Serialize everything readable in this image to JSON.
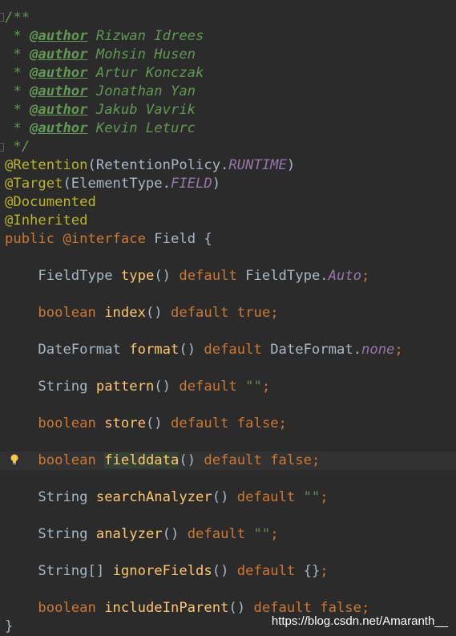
{
  "doc": {
    "open": "/**",
    "star": " * ",
    "author_tag": "@author",
    "authors": [
      "Rizwan Idrees",
      "Mohsin Husen",
      "Artur Konczak",
      "Jonathan Yan",
      "Jakub Vavrik",
      "Kevin Leturc"
    ],
    "close": " */"
  },
  "annotations": {
    "retention": "@Retention",
    "retention_arg": "RetentionPolicy.",
    "retention_const": "RUNTIME",
    "target": "@Target",
    "target_arg": "ElementType.",
    "target_const": "FIELD",
    "documented": "@Documented",
    "inherited": "@Inherited"
  },
  "declaration": {
    "public": "public",
    "at_interface": "@interface",
    "name": "Field",
    "open_brace": "{",
    "close_brace": "}"
  },
  "default_kw": "default",
  "methods": [
    {
      "type": "FieldType",
      "name": "type",
      "default_ref": "FieldType.",
      "default_const": "Auto"
    },
    {
      "type": "boolean",
      "name": "index",
      "default_literal": "true"
    },
    {
      "type": "DateFormat",
      "name": "format",
      "default_ref": "DateFormat.",
      "default_const": "none"
    },
    {
      "type": "String",
      "name": "pattern",
      "default_string": "\"\""
    },
    {
      "type": "boolean",
      "name": "store",
      "default_literal": "false"
    },
    {
      "type": "boolean",
      "name": "fielddata",
      "default_literal": "false"
    },
    {
      "type": "String",
      "name": "searchAnalyzer",
      "default_string": "\"\""
    },
    {
      "type": "String",
      "name": "analyzer",
      "default_string": "\"\""
    },
    {
      "type": "String[]",
      "name": "ignoreFields",
      "default_plain": "{}"
    },
    {
      "type": "boolean",
      "name": "includeInParent",
      "default_literal": "false"
    }
  ],
  "icons": {
    "bulb": "lightbulb-icon"
  },
  "watermark": "https://blog.csdn.net/Amaranth__",
  "colors": {
    "background": "#2b2b2b",
    "doc_comment": "#629755",
    "annotation": "#bbb529",
    "keyword": "#cc7832",
    "method": "#ffc66d",
    "constant": "#9876aa",
    "string": "#6a8759",
    "plain": "#a9b7c6"
  }
}
